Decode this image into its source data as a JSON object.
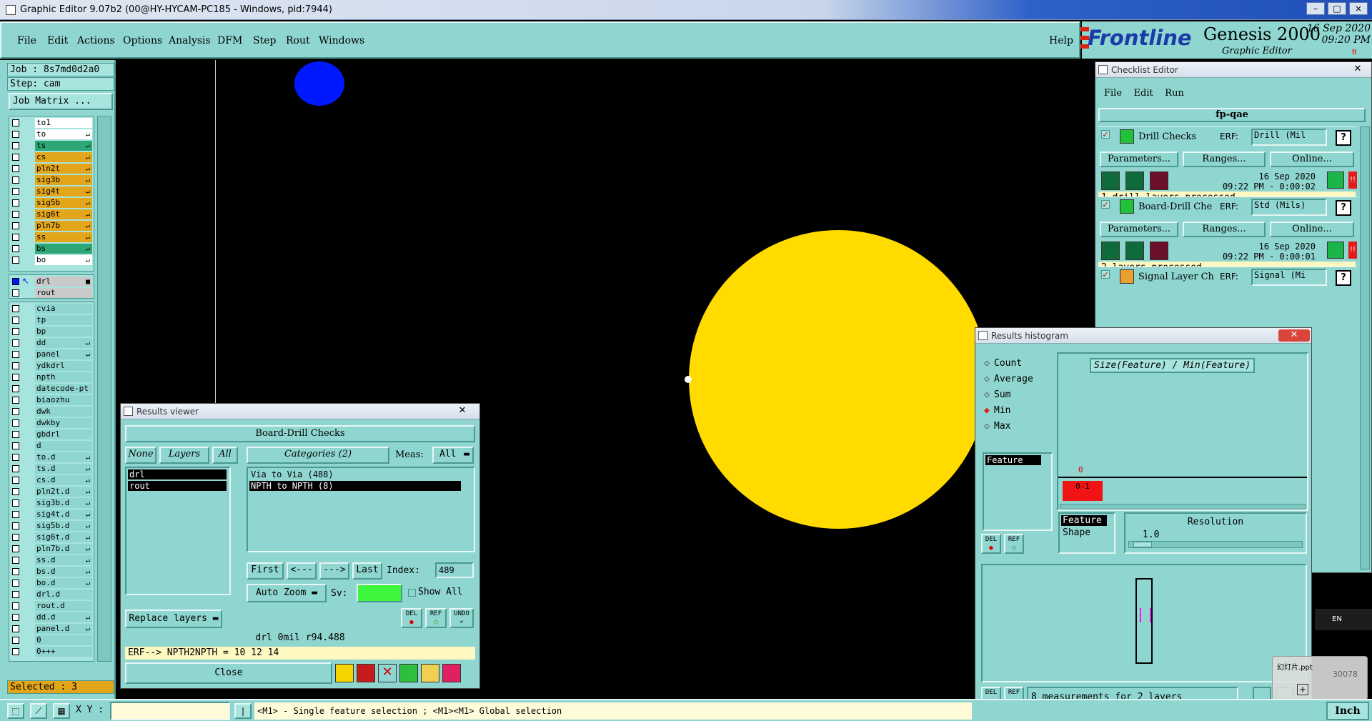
{
  "titlebar": {
    "title": "Graphic Editor 9.07b2 (00@HY-HYCAM-PC185 - Windows, pid:7944)",
    "min": "–",
    "max": "□",
    "close": "×"
  },
  "menubar": {
    "items": [
      "File",
      "Edit",
      "Actions",
      "Options",
      "Analysis",
      "DFM",
      "Step",
      "Rout",
      "Windows"
    ],
    "help": "Help"
  },
  "brand": {
    "logo": "Frontline",
    "product": "Genesis 2000",
    "subtitle": "Graphic Editor",
    "date": "16 Sep 2020",
    "time": "09:20 PM"
  },
  "left": {
    "job": "Job : 8s7md0d2a0",
    "step": "Step: cam",
    "job_matrix": "Job Matrix ...",
    "selected": "Selected : 3",
    "group1": [
      {
        "name": "to1",
        "color": "w"
      },
      {
        "name": "to",
        "color": "w",
        "mark": "↵"
      },
      {
        "name": "ts",
        "color": "g",
        "mark": "↵"
      },
      {
        "name": "cs",
        "color": "o",
        "mark": "↵"
      },
      {
        "name": "pln2t",
        "color": "o",
        "mark": "↵"
      },
      {
        "name": "sig3b",
        "color": "o",
        "mark": "↵"
      },
      {
        "name": "sig4t",
        "color": "o",
        "mark": "↵"
      },
      {
        "name": "sig5b",
        "color": "o",
        "mark": "↵"
      },
      {
        "name": "sig6t",
        "color": "o",
        "mark": "↵"
      },
      {
        "name": "pln7b",
        "color": "o",
        "mark": "↵"
      },
      {
        "name": "ss",
        "color": "o",
        "mark": "↵"
      },
      {
        "name": "bs",
        "color": "g",
        "mark": "↵"
      },
      {
        "name": "bo",
        "color": "w",
        "mark": "↵"
      }
    ],
    "group2": [
      {
        "name": "drl",
        "color": "s",
        "mark": "■"
      },
      {
        "name": "rout",
        "color": "s"
      }
    ],
    "group3": [
      {
        "name": "cvia"
      },
      {
        "name": "tp"
      },
      {
        "name": "bp"
      },
      {
        "name": "dd",
        "mark": "↵"
      },
      {
        "name": "panel",
        "mark": "↵"
      },
      {
        "name": "ydkdrl"
      },
      {
        "name": "npth"
      },
      {
        "name": "datecode-pt"
      },
      {
        "name": "biaozhu"
      },
      {
        "name": "dwk"
      },
      {
        "name": "dwkby"
      },
      {
        "name": "gbdrl"
      },
      {
        "name": "d"
      },
      {
        "name": "to.d",
        "mark": "↵"
      },
      {
        "name": "ts.d",
        "mark": "↵"
      },
      {
        "name": "cs.d",
        "mark": "↵"
      },
      {
        "name": "pln2t.d",
        "mark": "↵"
      },
      {
        "name": "sig3b.d",
        "mark": "↵"
      },
      {
        "name": "sig4t.d",
        "mark": "↵"
      },
      {
        "name": "sig5b.d",
        "mark": "↵"
      },
      {
        "name": "sig6t.d",
        "mark": "↵"
      },
      {
        "name": "pln7b.d",
        "mark": "↵"
      },
      {
        "name": "ss.d",
        "mark": "↵"
      },
      {
        "name": "bs.d",
        "mark": "↵"
      },
      {
        "name": "bo.d",
        "mark": "↵"
      },
      {
        "name": "drl.d"
      },
      {
        "name": "rout.d"
      },
      {
        "name": "dd.d",
        "mark": "↵"
      },
      {
        "name": "panel.d",
        "mark": "↵"
      },
      {
        "name": "0"
      },
      {
        "name": "0+++"
      }
    ]
  },
  "statusbar": {
    "xy_label": "X Y :",
    "xy_value": "",
    "hint": "<M1> - Single feature selection ; <M1><M1> Global selection",
    "units": "Inch",
    "lang": "EN"
  },
  "results_viewer": {
    "title": "Results viewer",
    "heading": "Board-Drill Checks",
    "none": "None",
    "layers": "Layers",
    "all": "All",
    "categories": "Categories (2)",
    "meas_label": "Meas:",
    "meas_value": "All",
    "layer_list": [
      "drl",
      "rout"
    ],
    "category_list": [
      "Via to Via  (488)",
      "NPTH to NPTH  (8)"
    ],
    "first": "First",
    "prev": "<---",
    "next": "--->",
    "last": "Last",
    "index_label": "Index:",
    "index_value": "489",
    "auto_zoom": "Auto Zoom",
    "sv_label": "Sv:",
    "show_all": "Show All",
    "replace_layers": "Replace layers",
    "del": "DEL",
    "ref": "REF",
    "undo": "UNDO",
    "info": "drl 0mil  r94.488",
    "erf": "ERF--> NPTH2NPTH = 10 12 14",
    "close": "Close"
  },
  "checklist": {
    "title": "Checklist Editor",
    "menu": [
      "File",
      "Edit",
      "Run"
    ],
    "name": "fp-qae",
    "param": "Parameters...",
    "ranges": "Ranges...",
    "online": "Online...",
    "erf_label": "ERF:",
    "checks": [
      {
        "name": "Drill Checks",
        "erf": "Drill (Mil",
        "date": "16 Sep 2020",
        "time": "09:22 PM - 0:00:02",
        "status": "1 drill layers processed"
      },
      {
        "name": "Board-Drill Che",
        "erf": "Std (Mils)",
        "date": "16 Sep 2020",
        "time": "09:22 PM - 0:00:01",
        "status": "2 layers processed"
      },
      {
        "name": "Signal Layer Ch",
        "erf": "Signal (Mi",
        "date": "",
        "time": "",
        "status": ""
      }
    ]
  },
  "histogram": {
    "title": "Results histogram",
    "options": [
      "Count",
      "Average",
      "Sum",
      "Min",
      "Max"
    ],
    "selected_option": "Min",
    "list_item": "Feature",
    "chart_title": "Size(Feature) / Min(Feature)",
    "bar_label": "0",
    "bar_text": "0-1",
    "feature": "Feature",
    "shape": "Shape",
    "resolution": "Resolution",
    "resolution_value": "1.0",
    "del": "DEL",
    "ref": "REF",
    "summary": "8 measurements for 2 layers"
  },
  "taskbar_popup": {
    "label": "幻灯片.ppt",
    "numbers": "30078"
  },
  "colors": {
    "accent": "#8fd6d0",
    "panel_light": "#a7e4de",
    "orange": "#e3a519",
    "green": "#2ea676",
    "yellow_feature": "#ffdb00",
    "blue_feature": "#0018ff"
  }
}
